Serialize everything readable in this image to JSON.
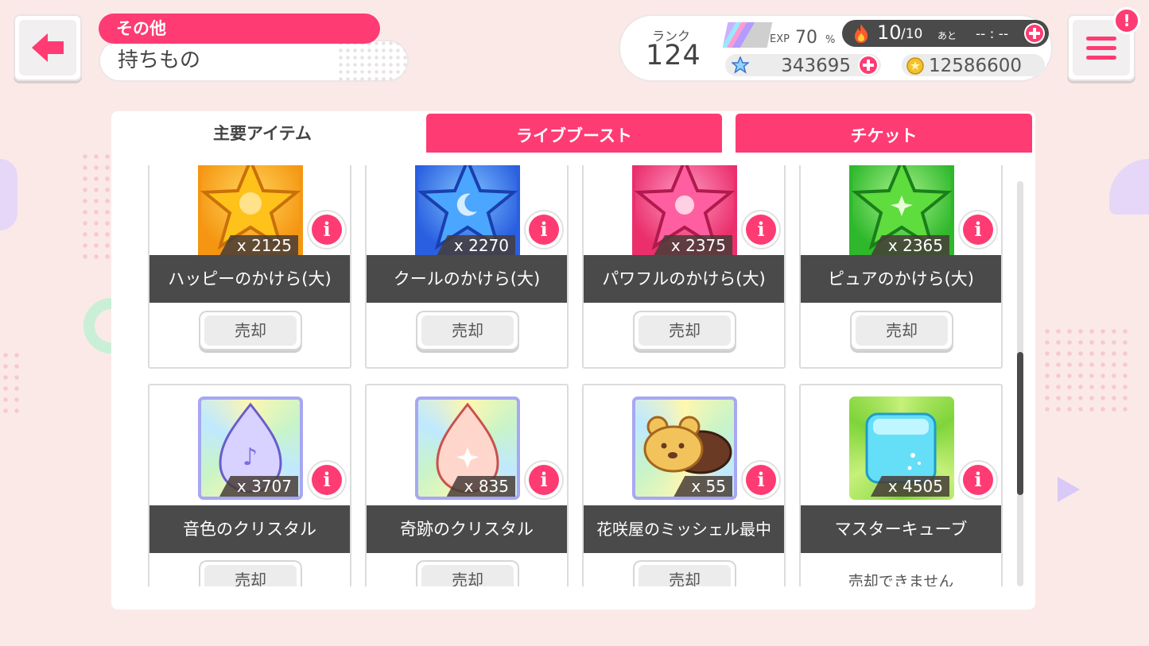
{
  "header": {
    "category": "その他",
    "title": "持ちもの"
  },
  "status": {
    "rank_label": "ランク",
    "rank": "124",
    "exp_label": "EXP",
    "exp_value": "70",
    "exp_unit": "%",
    "exp_progress": 0.7,
    "stamina_current": "10",
    "stamina_max": "/10",
    "stamina_next_label": "あと",
    "stamina_timer": "-- : --",
    "star_gems": "343695",
    "coins": "12586600"
  },
  "tabs": [
    {
      "label": "主要アイテム",
      "active": true
    },
    {
      "label": "ライブブースト",
      "active": false
    },
    {
      "label": "チケット",
      "active": false
    }
  ],
  "items": [
    {
      "name": "ハッピーのかけら(大)",
      "count": "x 2125",
      "icon": "happy-star-shard-icon",
      "color": "#f7a21b",
      "sell_label": "売却"
    },
    {
      "name": "クールのかけら(大)",
      "count": "x 2270",
      "icon": "cool-star-shard-icon",
      "color": "#2f77f0",
      "sell_label": "売却"
    },
    {
      "name": "パワフルのかけら(大)",
      "count": "x 2375",
      "icon": "powerful-star-shard-icon",
      "color": "#f03f7e",
      "sell_label": "売却"
    },
    {
      "name": "ピュアのかけら(大)",
      "count": "x 2365",
      "icon": "pure-star-shard-icon",
      "color": "#3fc83a",
      "sell_label": "売却"
    },
    {
      "name": "音色のクリスタル",
      "count": "x 3707",
      "icon": "tone-crystal-icon",
      "color": "#a8a7f2",
      "sell_label": "売却"
    },
    {
      "name": "奇跡のクリスタル",
      "count": "x 835",
      "icon": "miracle-crystal-icon",
      "color": "#a8a7f2",
      "sell_label": "売却"
    },
    {
      "name": "花咲屋のミッシェル最中",
      "count": "x 55",
      "icon": "michelle-monaka-icon",
      "color": "#a8a7f2",
      "sell_label": "売却"
    },
    {
      "name": "マスターキューブ",
      "count": "x 4505",
      "icon": "master-cube-icon",
      "color": "#6fd332",
      "sell_label": "売却できません"
    }
  ],
  "colors": {
    "accent": "#ff3b73",
    "dark_bar": "#4a4a4a",
    "background": "#fbe9e8"
  }
}
